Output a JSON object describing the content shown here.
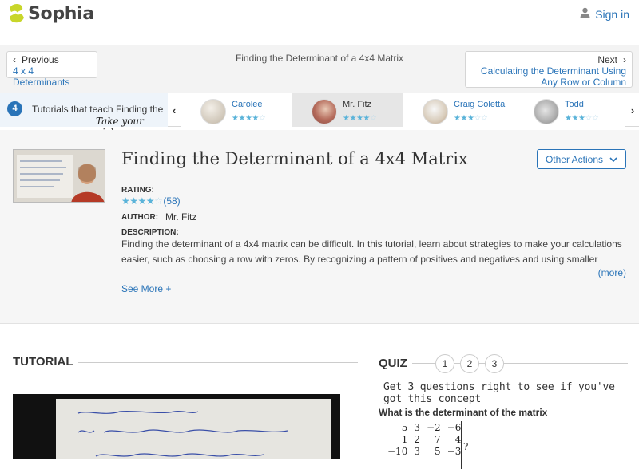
{
  "header": {
    "logo_text": "Sophia",
    "signin_label": "Sign in",
    "colors": {
      "brand_green": "#c8d62a",
      "link_blue": "#2a74b8"
    }
  },
  "nav": {
    "previous_label": "Previous",
    "previous_target": "4 x 4 Determinants",
    "page_title": "Finding the Determinant of a 4x4 Matrix",
    "next_label": "Next",
    "next_target": "Calculating the Determinant Using Any Row or Column"
  },
  "tutorial_strip": {
    "count": "4",
    "text": "Tutorials that teach Finding the",
    "pick_text": "Take your pick:",
    "cards": [
      {
        "name": "Carolee",
        "rating": 4,
        "active": false
      },
      {
        "name": "Mr. Fitz",
        "rating": 4,
        "active": true
      },
      {
        "name": "Craig Coletta",
        "rating": 3,
        "active": false
      },
      {
        "name": "Todd",
        "rating": 3,
        "active": false
      }
    ]
  },
  "details": {
    "title": "Finding the Determinant of a 4x4 Matrix",
    "other_actions_label": "Other Actions",
    "rating_label": "RATING:",
    "rating_stars": 4,
    "rating_count": "(58)",
    "author_label": "AUTHOR:",
    "author": "Mr. Fitz",
    "description_label": "DESCRIPTION:",
    "description": "Finding the determinant of a 4x4 matrix can be difficult. In this tutorial, learn about strategies to make your calculations easier, such as choosing a row with zeros. By recognizing a pattern of positives and negatives and using smaller",
    "more_label": "(more)",
    "see_more_label": "See More +"
  },
  "tutorial": {
    "heading": "TUTORIAL"
  },
  "quiz": {
    "heading": "QUIZ",
    "steps": [
      "1",
      "2",
      "3"
    ],
    "tagline": "Get 3 questions right to see if you've got this concept",
    "question": "What is the determinant of the matrix",
    "matrix": [
      [
        "5",
        "3",
        "−2",
        "−6"
      ],
      [
        "1",
        "2",
        "7",
        "4"
      ],
      [
        "−10",
        "3",
        "5",
        "−3"
      ]
    ],
    "question_mark": "?"
  }
}
